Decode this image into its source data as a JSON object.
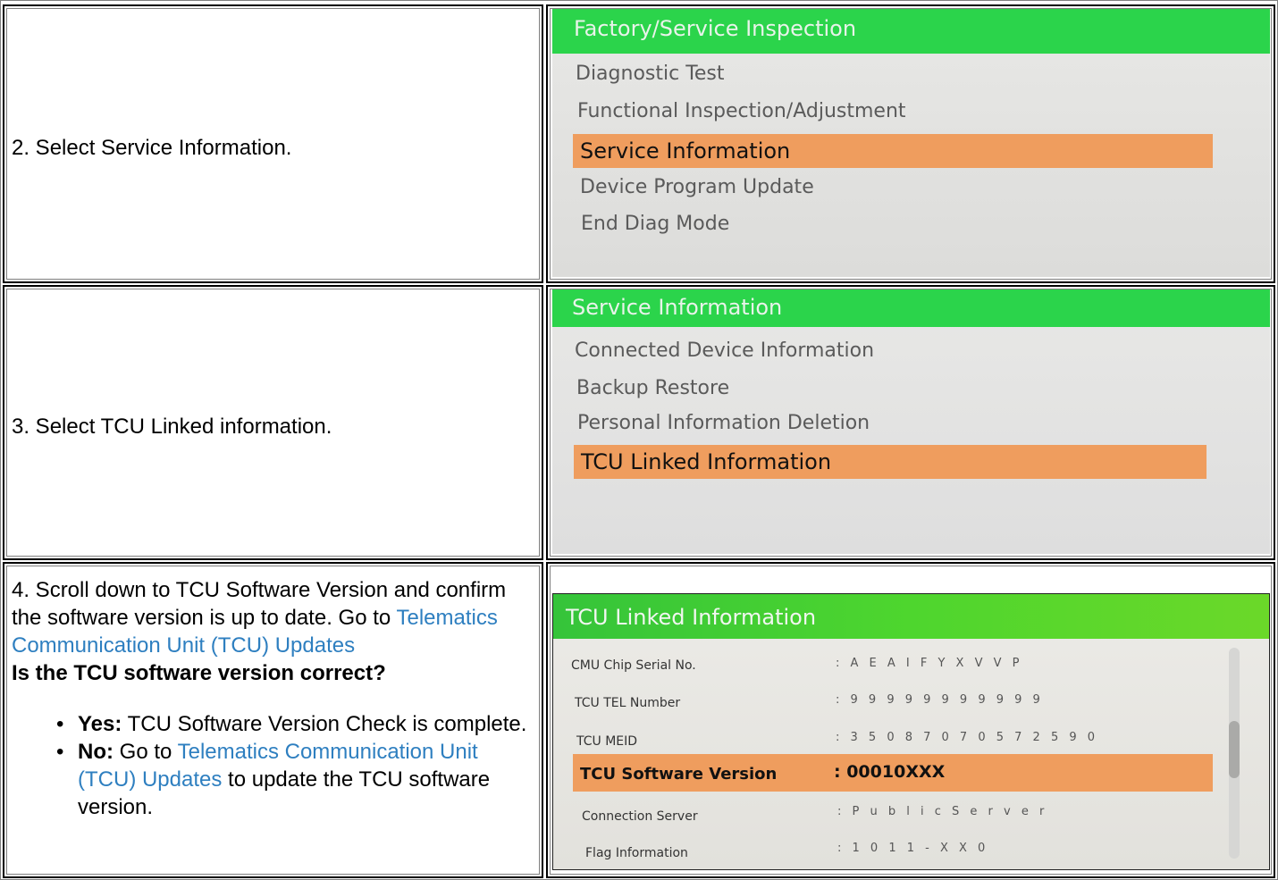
{
  "rows": [
    {
      "step_text": "2. Select Service Information.",
      "screen": {
        "title": "Factory/Service Inspection",
        "items": [
          "Diagnostic Test",
          "Functional Inspection/Adjustment",
          "Service Information",
          "Device Program Update",
          "End Diag Mode"
        ],
        "selected": "Service Information"
      }
    },
    {
      "step_text": "3. Select TCU Linked information.",
      "screen": {
        "title": "Service Information",
        "items": [
          "Connected Device Information",
          "Backup Restore",
          "Personal Information Deletion",
          "TCU Linked Information"
        ],
        "selected": "TCU Linked Information"
      }
    },
    {
      "step_intro": "4. Scroll down to TCU Software Version and confirm the software version is up to date. Go to",
      "link_text": "Telematics Communication Unit (TCU) Updates",
      "question": "Is the TCU software version correct?",
      "answers": [
        {
          "label": "Yes:",
          "text": "TCU Software Version Check is complete."
        },
        {
          "label": "No:",
          "pre": "Go to",
          "link": "Telematics Communication Unit (TCU) Updates",
          "post": "to update the TCU software version."
        }
      ],
      "bullet": "•",
      "screen": {
        "title": "TCU Linked Information",
        "fields": [
          {
            "label": "CMU Chip Serial No.",
            "value": ": A E A I F Y X V V P"
          },
          {
            "label": "TCU TEL Number",
            "value": ": 9 9 9 9 9 9 9 9 9 9 9"
          },
          {
            "label": "TCU MEID",
            "value": ": 3 5 0 8 7 0 7 0 5 7 2 5 9 0"
          },
          {
            "label": "TCU Software Version",
            "value": ": 00010XXX"
          },
          {
            "label": "Connection Server",
            "value": ": P u b l i c   S e r v e r"
          },
          {
            "label": "Flag Information",
            "value": ": 1 0 1 1 - X X 0"
          }
        ],
        "selected": "TCU Software Version"
      }
    }
  ],
  "colors": {
    "header_green": "#2bd44b",
    "selection_orange": "#ef9d5e",
    "link_blue": "#2e7fc0"
  }
}
